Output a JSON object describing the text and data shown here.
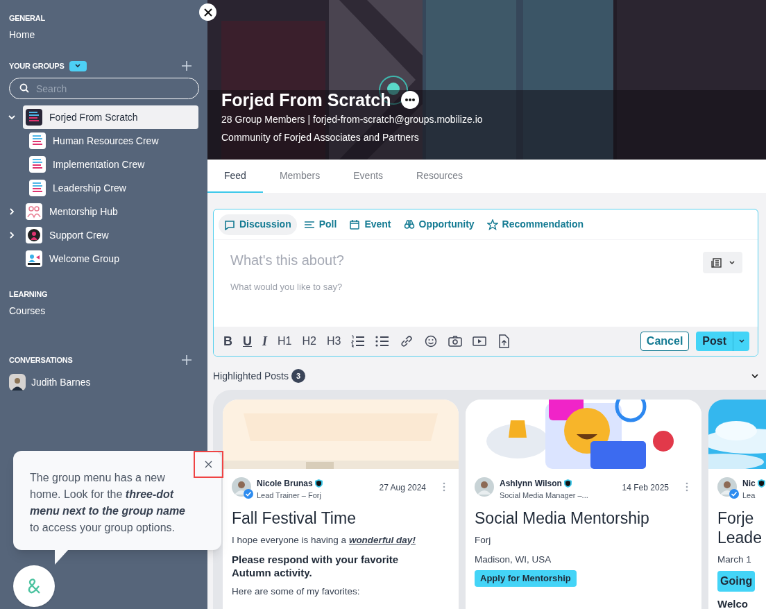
{
  "sidebar": {
    "sections": [
      {
        "kind": "links",
        "heading": "GENERAL",
        "items": [
          "Home"
        ]
      },
      {
        "kind": "groups",
        "heading": "YOUR GROUPS",
        "search": {
          "placeholder": "Search"
        },
        "groups": [
          {
            "label": "Forjed From Scratch",
            "selected": true,
            "expanded": true,
            "children": [
              {
                "label": "Human Resources Crew",
                "selected": false
              },
              {
                "label": "Implementation Crew",
                "selected": false
              },
              {
                "label": "Leadership Crew",
                "selected": false
              }
            ]
          },
          {
            "label": "Mentorship Hub",
            "selected": false,
            "expanded": false
          },
          {
            "label": "Support Crew",
            "selected": false,
            "expanded": false
          },
          {
            "label": "Welcome Group",
            "selected": false
          }
        ]
      },
      {
        "kind": "links",
        "heading": "LEARNING",
        "items": [
          "Courses"
        ]
      },
      {
        "kind": "people",
        "heading": "CONVERSATIONS",
        "items": [
          "Judith Barnes"
        ]
      }
    ]
  },
  "group": {
    "title": "Forjed From Scratch",
    "meta": "28 Group Members | forjed-from-scratch@groups.mobilize.io",
    "description": "Community of Forjed Associates and Partners"
  },
  "tabs": [
    {
      "label": "Feed",
      "selected": true
    },
    {
      "label": "Members",
      "selected": false
    },
    {
      "label": "Events",
      "selected": false
    },
    {
      "label": "Resources",
      "selected": false
    }
  ],
  "composer": {
    "types": [
      {
        "label": "Discussion",
        "selected": true
      },
      {
        "label": "Poll",
        "selected": false
      },
      {
        "label": "Event",
        "selected": false
      },
      {
        "label": "Opportunity",
        "selected": false
      },
      {
        "label": "Recommendation",
        "selected": false
      }
    ],
    "title_placeholder": "What's this about?",
    "body_placeholder": "What would you like to say?",
    "format": [
      {
        "kind": "bold",
        "label": "B"
      },
      {
        "kind": "underline",
        "label": "U"
      },
      {
        "kind": "italic",
        "label": "I"
      },
      {
        "kind": "heading",
        "label": "H1"
      },
      {
        "kind": "heading",
        "label": "H2"
      },
      {
        "kind": "heading",
        "label": "H3"
      }
    ],
    "cancel": "Cancel",
    "post": "Post"
  },
  "highlighted": {
    "label": "Highlighted Posts",
    "count": "3",
    "cards": [
      {
        "author": "Nicole Brunas",
        "verified": true,
        "role": "Lead Trainer – Forj",
        "date": "27 Aug 2024",
        "title": "Fall Festival Time",
        "blocks": [
          {
            "kind": "text",
            "text": "I hope everyone is having a **wonderful day!**"
          },
          {
            "kind": "strong",
            "text": "Please respond with your favorite Autumn activity."
          },
          {
            "kind": "text",
            "text": "Here are some of my favorites:"
          }
        ]
      },
      {
        "author": "Ashlynn Wilson",
        "verified": false,
        "role": "Social Media Manager –...",
        "date": "14 Feb 2025",
        "title": "Social Media Mentorship",
        "blocks": [
          {
            "kind": "text",
            "text": "Forj"
          },
          {
            "kind": "text",
            "text": "Madison, WI, USA"
          },
          {
            "kind": "button",
            "text": "Apply for Mentorship"
          }
        ]
      },
      {
        "author": "Nic",
        "verified": true,
        "role": "Lea",
        "title": "Forje Leade",
        "blocks": [
          {
            "kind": "text",
            "text": "March 1"
          },
          {
            "kind": "bigbutton",
            "text": "Going"
          },
          {
            "kind": "strong",
            "text": "Welco"
          }
        ]
      }
    ]
  },
  "tip": {
    "text": "The group menu has a new home. Look for the **three-dot menu next to the group name** to access your group options."
  }
}
